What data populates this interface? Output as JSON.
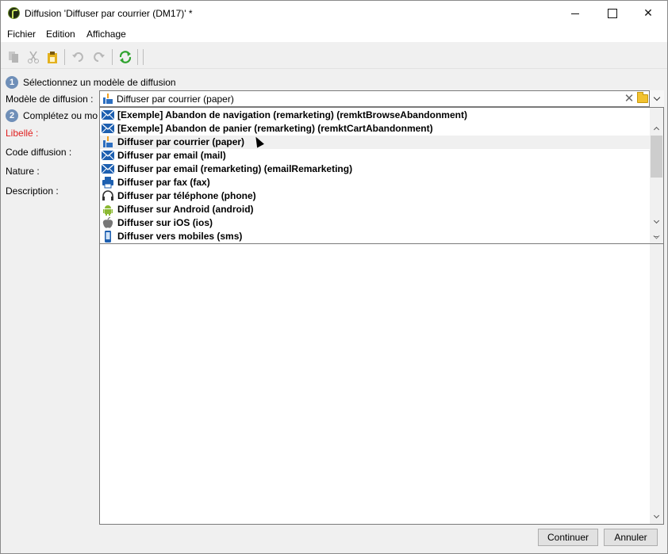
{
  "window": {
    "title": "Diffusion 'Diffuser par courrier (DM17)' *"
  },
  "menu": {
    "items": [
      "Fichier",
      "Edition",
      "Affichage"
    ]
  },
  "steps": [
    {
      "number": "1",
      "label": "Sélectionnez un modèle de diffusion"
    },
    {
      "number": "2",
      "label": "Complétez ou mo"
    }
  ],
  "fields": {
    "model_label": "Modèle de diffusion :",
    "libelle_label": "Libellé :",
    "code_label": "Code diffusion :",
    "nature_label": "Nature :",
    "description_label": "Description :"
  },
  "combo": {
    "selected": "Diffuser par courrier (paper)",
    "icon": "paper-mail-icon"
  },
  "dropdown": {
    "items": [
      {
        "label": "[Exemple] Abandon de navigation (remarketing) (remktBrowseAbandonment)",
        "icon": "email-icon"
      },
      {
        "label": "[Exemple] Abandon de panier (remarketing) (remktCartAbandonment)",
        "icon": "email-icon"
      },
      {
        "label": "Diffuser par courrier (paper)",
        "icon": "paper-mail-icon"
      },
      {
        "label": "Diffuser par email (mail)",
        "icon": "email-icon"
      },
      {
        "label": "Diffuser par email (remarketing) (emailRemarketing)",
        "icon": "email-icon"
      },
      {
        "label": "Diffuser par fax (fax)",
        "icon": "fax-icon"
      },
      {
        "label": "Diffuser par téléphone (phone)",
        "icon": "headset-icon"
      },
      {
        "label": "Diffuser sur Android (android)",
        "icon": "android-icon"
      },
      {
        "label": "Diffuser sur iOS (ios)",
        "icon": "apple-icon"
      },
      {
        "label": "Diffuser vers mobiles (sms)",
        "icon": "mobile-icon"
      }
    ],
    "hovered_index": 2
  },
  "buttons": {
    "continue": "Continuer",
    "cancel": "Annuler"
  },
  "colors": {
    "required_label": "#e02020",
    "step_badge": "#6f8fb8",
    "email_icon": "#1d5fb0"
  }
}
